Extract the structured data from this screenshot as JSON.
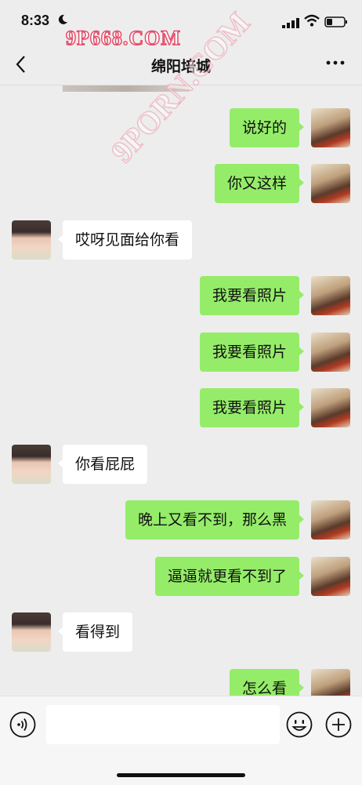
{
  "status": {
    "time": "8:33"
  },
  "watermarks": {
    "top": "9P668.COM",
    "diagonal": "9PORN.COM"
  },
  "header": {
    "title": "绵阳培城"
  },
  "messages": [
    {
      "side": "right",
      "text": "说好的"
    },
    {
      "side": "right",
      "text": "你又这样"
    },
    {
      "side": "left",
      "text": "哎呀见面给你看"
    },
    {
      "side": "right",
      "text": "我要看照片"
    },
    {
      "side": "right",
      "text": "我要看照片"
    },
    {
      "side": "right",
      "text": "我要看照片"
    },
    {
      "side": "left",
      "text": "你看屁屁"
    },
    {
      "side": "right",
      "text": "晚上又看不到，那么黑"
    },
    {
      "side": "right",
      "text": "逼逼就更看不到了"
    },
    {
      "side": "left",
      "text": "看得到"
    },
    {
      "side": "right",
      "text": "怎么看"
    }
  ],
  "input": {
    "value": ""
  }
}
